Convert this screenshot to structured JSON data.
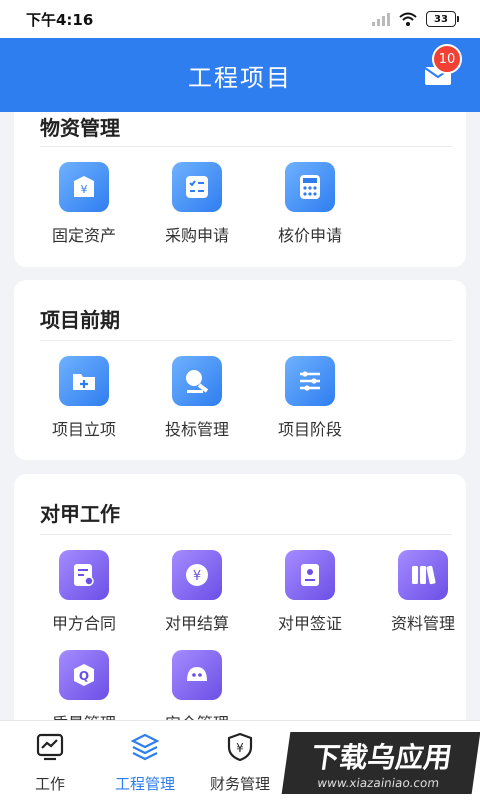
{
  "status_bar": {
    "time": "下午4:16",
    "battery": "33"
  },
  "header": {
    "title": "工程项目",
    "badge_count": "10"
  },
  "sections": [
    {
      "title": "物资管理",
      "items": [
        {
          "label": "固定资产",
          "icon": "yen-shield-icon",
          "color": "#2f7ef0"
        },
        {
          "label": "采购申请",
          "icon": "checklist-icon",
          "color": "#2f7ef0"
        },
        {
          "label": "核价申请",
          "icon": "calculator-icon",
          "color": "#2f7ef0"
        }
      ]
    },
    {
      "title": "项目前期",
      "items": [
        {
          "label": "项目立项",
          "icon": "folder-plus-icon",
          "color": "#2f7ef0"
        },
        {
          "label": "投标管理",
          "icon": "hammer-icon",
          "color": "#2f7ef0"
        },
        {
          "label": "项目阶段",
          "icon": "sliders-icon",
          "color": "#2f7ef0"
        }
      ]
    },
    {
      "title": "对甲工作",
      "items": [
        {
          "label": "甲方合同",
          "icon": "contract-icon",
          "color": "#6c4fe6"
        },
        {
          "label": "对甲结算",
          "icon": "yen-circle-icon",
          "color": "#6c4fe6"
        },
        {
          "label": "对甲签证",
          "icon": "certificate-icon",
          "color": "#6c4fe6"
        },
        {
          "label": "资料管理",
          "icon": "books-icon",
          "color": "#6c4fe6"
        },
        {
          "label": "质量管理",
          "icon": "quality-q-icon",
          "color": "#6c4fe6"
        },
        {
          "label": "安全管理",
          "icon": "helmet-icon",
          "color": "#6c4fe6"
        }
      ]
    }
  ],
  "bottom_nav": [
    {
      "label": "工作",
      "icon": "chart-monitor-icon",
      "active": false
    },
    {
      "label": "工程管理",
      "icon": "layers-icon",
      "active": true
    },
    {
      "label": "财务管理",
      "icon": "yen-shield-icon",
      "active": false
    }
  ],
  "watermark": {
    "text": "下载乌应用",
    "url_text": "www.xiazainiao.com"
  }
}
